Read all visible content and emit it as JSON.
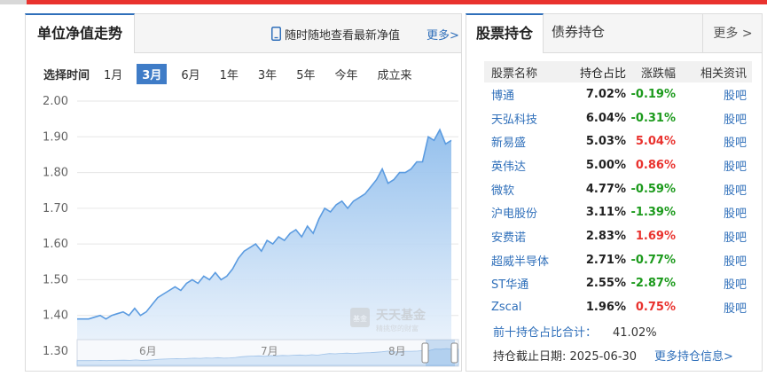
{
  "nav_panel": {
    "title": "单位净值走势",
    "phone_link": "随时随地查看最新净值",
    "more": "更多>",
    "range_label": "选择时间",
    "ranges": [
      "1月",
      "3月",
      "6月",
      "1年",
      "3年",
      "5年",
      "今年",
      "成立来"
    ],
    "active_range": "3月",
    "watermark_title": "天天基金",
    "watermark_sub": "精挑您的财富",
    "watermark_badge": "基金"
  },
  "chart_data": {
    "type": "area",
    "title": "",
    "xlabel": "",
    "ylabel": "",
    "ylim": [
      1.3,
      2.0
    ],
    "yticks": [
      "2.00",
      "1.90",
      "1.80",
      "1.70",
      "1.60",
      "1.50",
      "1.40",
      "1.30"
    ],
    "navigator_labels": [
      "6月",
      "7月",
      "8月"
    ],
    "grid": true,
    "series": [
      {
        "values": [
          1.39,
          1.39,
          1.39,
          1.395,
          1.4,
          1.39,
          1.4,
          1.405,
          1.41,
          1.4,
          1.42,
          1.4,
          1.41,
          1.43,
          1.45,
          1.46,
          1.47,
          1.48,
          1.47,
          1.49,
          1.5,
          1.49,
          1.51,
          1.5,
          1.52,
          1.5,
          1.51,
          1.53,
          1.56,
          1.58,
          1.59,
          1.6,
          1.58,
          1.61,
          1.6,
          1.62,
          1.61,
          1.63,
          1.64,
          1.62,
          1.65,
          1.63,
          1.67,
          1.7,
          1.69,
          1.71,
          1.72,
          1.7,
          1.72,
          1.73,
          1.74,
          1.76,
          1.78,
          1.81,
          1.77,
          1.78,
          1.8,
          1.8,
          1.81,
          1.83,
          1.83,
          1.9,
          1.89,
          1.92,
          1.88,
          1.89
        ]
      }
    ]
  },
  "holdings_panel": {
    "tab_active": "股票持仓",
    "tab_inactive": "债券持仓",
    "more": "更多 >",
    "columns": [
      "股票名称",
      "持仓占比",
      "涨跌幅",
      "相关资讯"
    ],
    "rows": [
      {
        "name": "博通",
        "pct": "7.02%",
        "change": "-0.19%",
        "dir": "down",
        "link": "股吧"
      },
      {
        "name": "天弘科技",
        "pct": "6.04%",
        "change": "-0.31%",
        "dir": "down",
        "link": "股吧"
      },
      {
        "name": "新易盛",
        "pct": "5.03%",
        "change": "5.04%",
        "dir": "up",
        "link": "股吧"
      },
      {
        "name": "英伟达",
        "pct": "5.00%",
        "change": "0.86%",
        "dir": "up",
        "link": "股吧"
      },
      {
        "name": "微软",
        "pct": "4.77%",
        "change": "-0.59%",
        "dir": "down",
        "link": "股吧"
      },
      {
        "name": "沪电股份",
        "pct": "3.11%",
        "change": "-1.39%",
        "dir": "down",
        "link": "股吧"
      },
      {
        "name": "安费诺",
        "pct": "2.83%",
        "change": "1.69%",
        "dir": "up",
        "link": "股吧"
      },
      {
        "name": "超威半导体",
        "pct": "2.71%",
        "change": "-0.77%",
        "dir": "down",
        "link": "股吧"
      },
      {
        "name": "ST华通",
        "pct": "2.55%",
        "change": "-2.87%",
        "dir": "down",
        "link": "股吧"
      },
      {
        "name": "Zscal",
        "pct": "1.96%",
        "change": "0.75%",
        "dir": "up",
        "link": "股吧"
      }
    ],
    "summary_label": "前十持仓占比合计：",
    "summary_value": "41.02%",
    "deadline": "持仓截止日期: 2025-06-30",
    "more_holdings": "更多持仓信息>"
  },
  "colors": {
    "accent_blue": "#2f6fba",
    "up_red": "#e9322e",
    "down_green": "#1c9a1c",
    "line": "#5b9be0",
    "area_fill": "#a9cdf2"
  }
}
